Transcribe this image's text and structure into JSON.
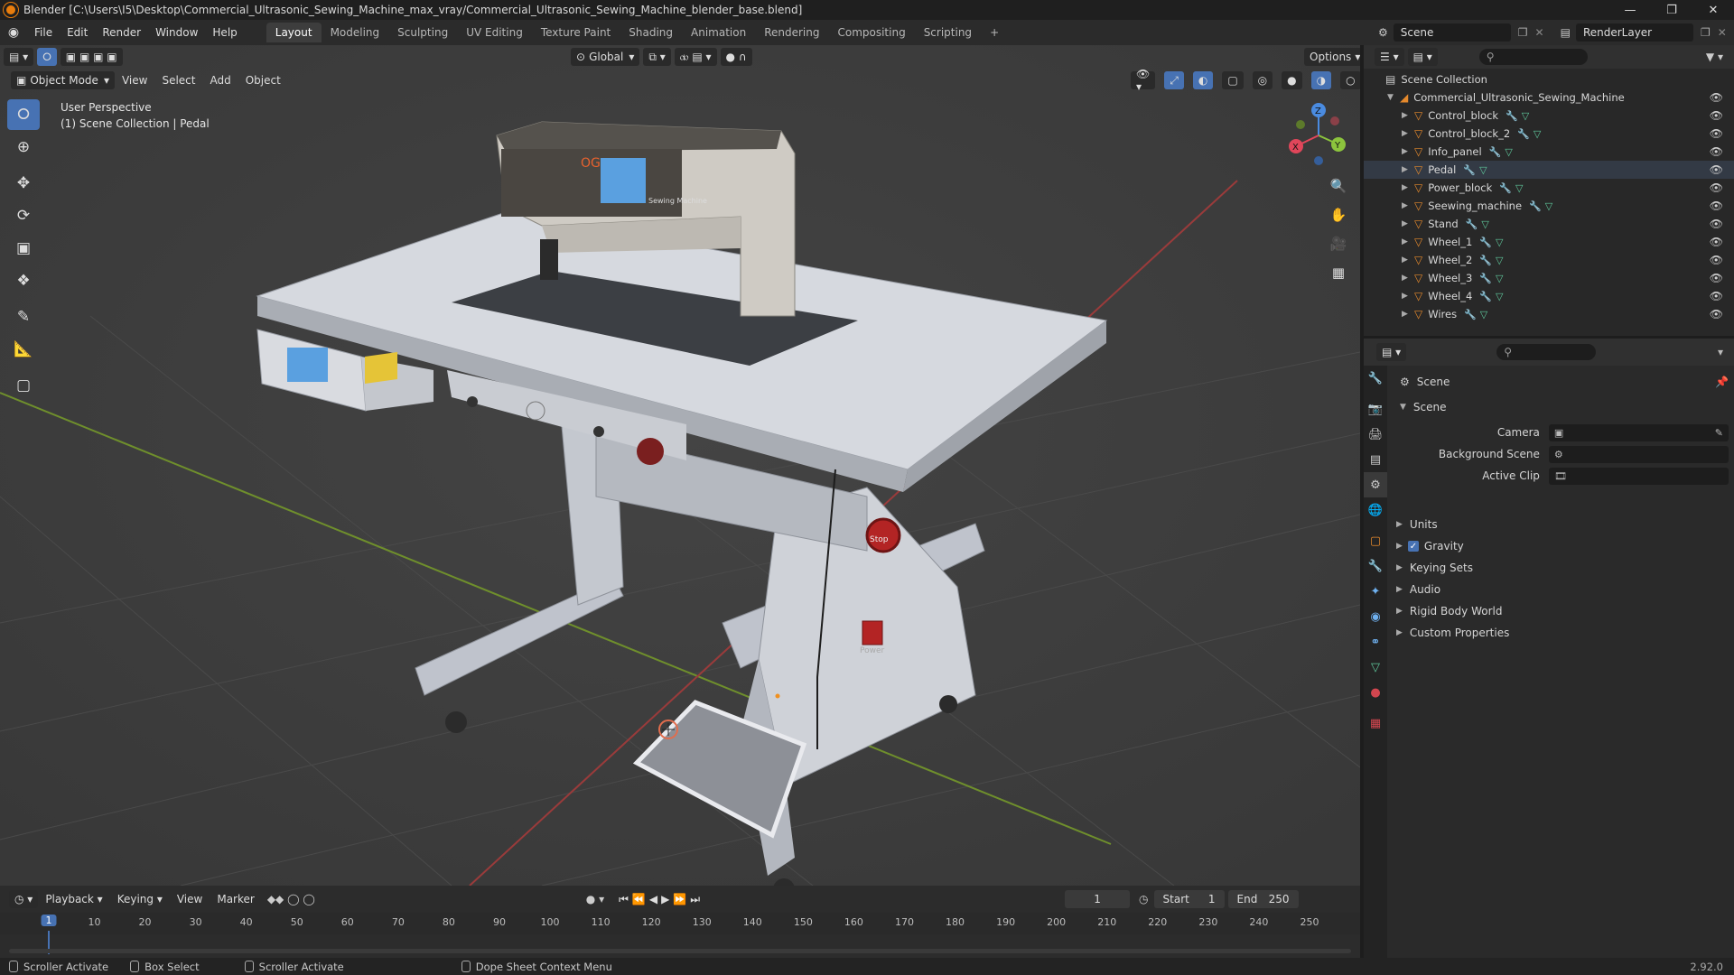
{
  "window": {
    "title": "Blender [C:\\Users\\I5\\Desktop\\Commercial_Ultrasonic_Sewing_Machine_max_vray/Commercial_Ultrasonic_Sewing_Machine_blender_base.blend]",
    "min_icon": "minimize-icon",
    "max_icon": "maximize-icon",
    "close_icon": "close-icon"
  },
  "menu": {
    "items": [
      "File",
      "Edit",
      "Render",
      "Window",
      "Help"
    ]
  },
  "workspaces": [
    "Layout",
    "Modeling",
    "Sculpting",
    "UV Editing",
    "Texture Paint",
    "Shading",
    "Animation",
    "Rendering",
    "Compositing",
    "Scripting",
    "+"
  ],
  "active_workspace": "Layout",
  "scene_selector": {
    "label": "Scene"
  },
  "view_layer_selector": {
    "label": "RenderLayer"
  },
  "viewport": {
    "mode": "Object Mode",
    "header_menus": [
      "View",
      "Select",
      "Add",
      "Object"
    ],
    "transform_orientation": "Global",
    "options_label": "Options",
    "overlay_title": "User Perspective",
    "overlay_subtitle": "(1) Scene Collection | Pedal",
    "gizmo_axes": {
      "x": "X",
      "y": "Y",
      "z": "Z"
    },
    "machine_screen_text": "OG",
    "machine_brand": "Sewing Machine",
    "stop_label": "Stop",
    "power_label": "Power"
  },
  "outliner": {
    "root": "Scene Collection",
    "collection": "Commercial_Ultrasonic_Sewing_Machine",
    "objects": [
      "Control_block",
      "Control_block_2",
      "Info_panel",
      "Pedal",
      "Power_block",
      "Seewing_machine",
      "Stand",
      "Wheel_1",
      "Wheel_2",
      "Wheel_3",
      "Wheel_4",
      "Wires"
    ],
    "selected": "Pedal"
  },
  "properties": {
    "context": "Scene",
    "panel": "Scene",
    "fields": [
      {
        "label": "Camera",
        "value": ""
      },
      {
        "label": "Background Scene",
        "value": ""
      },
      {
        "label": "Active Clip",
        "value": ""
      }
    ],
    "sections": [
      "Units",
      "Gravity",
      "Keying Sets",
      "Audio",
      "Rigid Body World",
      "Custom Properties"
    ],
    "gravity_checked": true
  },
  "timeline": {
    "menus": [
      "Playback",
      "Keying",
      "View",
      "Marker"
    ],
    "current_frame": "1",
    "start_label": "Start",
    "start": "1",
    "end_label": "End",
    "end": "250",
    "ruler": [
      "10",
      "20",
      "30",
      "40",
      "50",
      "60",
      "70",
      "80",
      "90",
      "100",
      "110",
      "120",
      "130",
      "140",
      "150",
      "160",
      "170",
      "180",
      "190",
      "200",
      "210",
      "220",
      "230",
      "240",
      "250"
    ],
    "cursor_label": "1"
  },
  "statusbar": {
    "items": [
      "Scroller Activate",
      "Box Select",
      "Scroller Activate",
      "Dope Sheet Context Menu"
    ],
    "version": "2.92.0"
  }
}
